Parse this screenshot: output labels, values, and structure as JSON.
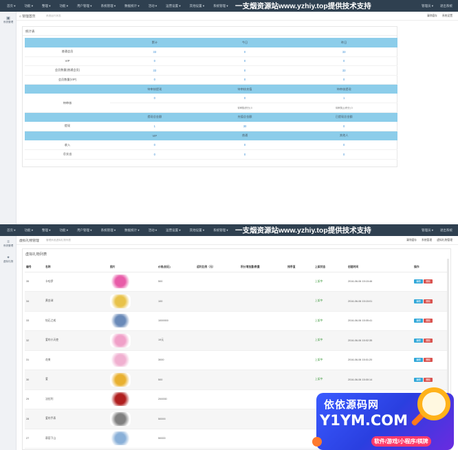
{
  "nav": {
    "menu": [
      "首页 ▾",
      "功能 ▾",
      "整理 ▾",
      "功能 ▾",
      "用户管理 ▾",
      "系统管理 ▾",
      "数据统计 ▾",
      "活动 ▾",
      "运营设置 ▾",
      "其他设置 ▾",
      "系统管理 ▾"
    ],
    "banner": "一支烟资源站www.yzhiy.top提供技术支持",
    "right": [
      "管理员 ▾",
      "退出系统"
    ]
  },
  "top": {
    "sidebar_label": "系统管理",
    "crumb": "⌂ 管理首页",
    "crumb_sub": "系统运行状态",
    "links": [
      "清除缓存",
      "系统设置"
    ],
    "panel_title": "统计表",
    "sections": [
      {
        "header": [
          "",
          "累计",
          "今日",
          "昨日"
        ],
        "rows": [
          {
            "label": "普通会员",
            "values": [
              "33",
              "0",
              "33"
            ]
          },
          {
            "label": "VIP",
            "values": [
              "0",
              "0",
              "0"
            ]
          },
          {
            "label": "会员数量(普通会员)",
            "values": [
              "33",
              "0",
              "33"
            ]
          },
          {
            "label": "会员数量(VIP)",
            "values": [
              "0",
              "0",
              "0"
            ]
          }
        ]
      },
      {
        "header": [
          "",
          "待审核提现",
          "待审核充值",
          "待审核提现"
        ],
        "label": "待审核",
        "values": [
          "0",
          "0",
          "1"
        ],
        "notes": [
          "",
          "待审核(积分)  0",
          "待审核(公积分)  0"
        ]
      },
      {
        "header": [
          "",
          "提现总金额",
          "充值总金额",
          "已提现总金额"
        ],
        "rows": [
          {
            "label": "提现",
            "values": [
              "1",
              "30",
              "0"
            ]
          }
        ]
      },
      {
        "header": [
          "",
          "VIP",
          "普通",
          "其他人"
        ],
        "rows": [
          {
            "label": "收入",
            "values": [
              "0",
              "0",
              "0"
            ]
          },
          {
            "label": "总支出",
            "values": [
              "0",
              "0",
              "0"
            ]
          }
        ]
      }
    ]
  },
  "bottom": {
    "sidebar": [
      {
        "icon": "≡",
        "label": "系统管理"
      },
      {
        "icon": "✦",
        "label": "虚拟礼物"
      }
    ],
    "crumb": "虚拟礼物管理",
    "crumb_sub": "管理系统虚拟礼物列表",
    "links": [
      "清除缓存",
      "系统管理",
      "虚拟礼物管理"
    ],
    "box_title": "虚拟礼物列表",
    "columns": [
      "编号",
      "名称",
      "图片",
      "价格(钻石)",
      "返利比例（元）",
      "积分增加量/数量",
      "排序值",
      "上架状态",
      "创建时间",
      "操作"
    ],
    "rows": [
      {
        "id": "35",
        "name": "卡哇伊",
        "price": "500",
        "status": "上架中",
        "time": "2016-06-06 15:15:46",
        "color": "#e85ca8"
      },
      {
        "id": "34",
        "name": "黄金球",
        "price": "100",
        "status": "上架中",
        "time": "2016-06-06 15:15:01",
        "color": "#e8c24a"
      },
      {
        "id": "33",
        "name": "钻石之戒",
        "price": "1000000",
        "status": "上架中",
        "time": "2016-06-06 15:05:41",
        "color": "#6a8ab8"
      },
      {
        "id": "32",
        "name": "爱的小天使",
        "price": "19元",
        "status": "上架中",
        "time": "2016-06-06 15:02:35",
        "color": "#f0a0c8"
      },
      {
        "id": "31",
        "name": "花束",
        "price": "3000",
        "status": "上架中",
        "time": "2016-06-06 15:01:20",
        "color": "#f0b0d0"
      },
      {
        "id": "30",
        "name": "爱",
        "price": "500",
        "status": "上架中",
        "time": "2016-06-06 15:00:14",
        "color": "#e8b030"
      },
      {
        "id": "29",
        "name": "法拉利",
        "price": "200000",
        "status": "",
        "time": "",
        "color": "#b02020"
      },
      {
        "id": "28",
        "name": "爱的手表",
        "price": "50000",
        "status": "",
        "time": "",
        "color": "#808080"
      },
      {
        "id": "27",
        "name": "慕容下山",
        "price": "50000",
        "status": "",
        "time": "",
        "color": "#8ab0d8"
      }
    ],
    "edit_label": "编辑",
    "delete_label": "删除"
  },
  "promo": {
    "line1": "依依源码网",
    "line2": "Y1YM.COM",
    "line3": "软件/游戏/小程序/棋牌"
  }
}
